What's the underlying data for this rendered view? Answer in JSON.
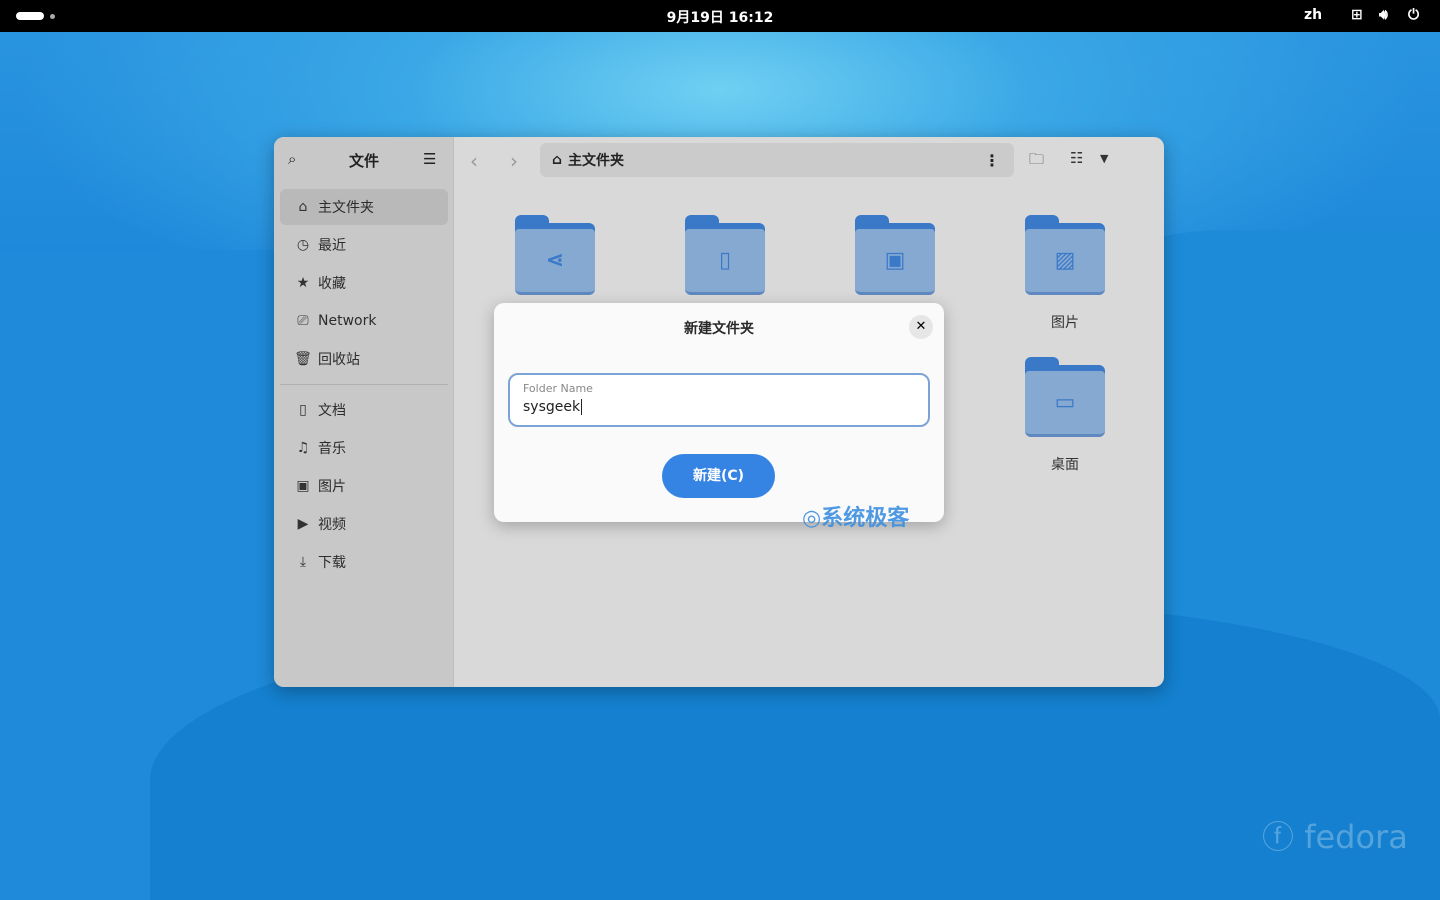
{
  "topbar": {
    "clock": "9月19日  16:12",
    "lang": "zh",
    "icons": [
      "network-icon",
      "volume-icon",
      "power-icon"
    ]
  },
  "sidebar": {
    "title": "文件",
    "items": [
      {
        "label": "主文件夹",
        "icon": "home-icon",
        "selected": true
      },
      {
        "label": "最近",
        "icon": "clock-icon"
      },
      {
        "label": "收藏",
        "icon": "star-icon"
      },
      {
        "label": "Network",
        "icon": "network-icon"
      },
      {
        "label": "回收站",
        "icon": "trash-icon"
      },
      {
        "label": "文档",
        "icon": "document-icon"
      },
      {
        "label": "音乐",
        "icon": "music-icon"
      },
      {
        "label": "图片",
        "icon": "image-icon"
      },
      {
        "label": "视频",
        "icon": "video-icon"
      },
      {
        "label": "下载",
        "icon": "download-icon"
      }
    ]
  },
  "pathbar": {
    "location": "主文件夹"
  },
  "folders": [
    {
      "label": "",
      "icon": "share-icon"
    },
    {
      "label": "",
      "icon": "document-icon"
    },
    {
      "label": "",
      "icon": "video-icon"
    },
    {
      "label": "图片",
      "icon": "image-icon"
    },
    {
      "label": "桌面",
      "icon": "folder-icon"
    }
  ],
  "dialog": {
    "title": "新建文件夹",
    "field_label": "Folder Name",
    "field_value": "sysgeek",
    "create_label": "新建(C)"
  },
  "watermark": "系统极客",
  "distro": "fedora"
}
